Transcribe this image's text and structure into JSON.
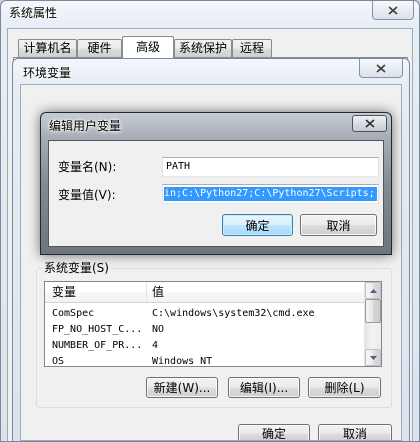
{
  "system_properties": {
    "title": "系统属性",
    "tabs": [
      {
        "label": "计算机名",
        "selected": false
      },
      {
        "label": "硬件",
        "selected": false
      },
      {
        "label": "高级",
        "selected": true
      },
      {
        "label": "系统保护",
        "selected": false
      },
      {
        "label": "远程",
        "selected": false
      }
    ]
  },
  "environment_variables": {
    "title": "环境变量",
    "system_variables": {
      "label": "系统变量(S)",
      "columns": {
        "name": "变量",
        "value": "值"
      },
      "rows": [
        {
          "name": "ComSpec",
          "value": "C:\\windows\\system32\\cmd.exe"
        },
        {
          "name": "FP_NO_HOST_C...",
          "value": "NO"
        },
        {
          "name": "NUMBER_OF_PR...",
          "value": "4"
        },
        {
          "name": "OS",
          "value": "Windows_NT"
        }
      ],
      "buttons": {
        "new": "新建(W)...",
        "edit": "编辑(I)...",
        "delete": "删除(L)"
      }
    },
    "ok_label": "确定",
    "cancel_label": "取消"
  },
  "edit_user_variable": {
    "title": "编辑用户变量",
    "name_label": "变量名(N):",
    "name_value": "PATH",
    "value_label": "变量值(V):",
    "value_value": "in;C:\\Python27;C:\\Python27\\Scripts;",
    "ok_label": "确定",
    "cancel_label": "取消"
  },
  "colors": {
    "selection": "#3399ff",
    "default_button_border": "#3c7fb1",
    "dialog_background": "#f0f0f0"
  }
}
